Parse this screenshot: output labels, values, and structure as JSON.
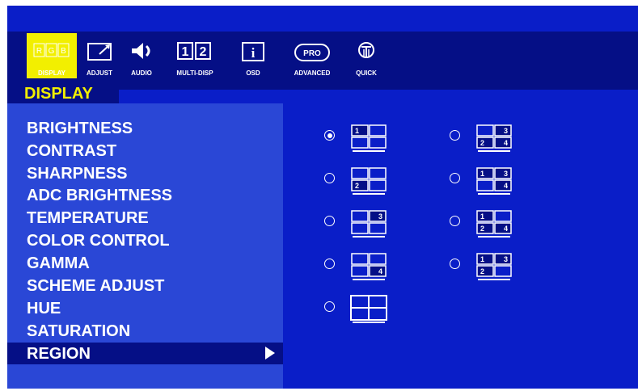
{
  "tabs": [
    {
      "label": "DISPLAY",
      "icon": "rgb-icon",
      "selected": true,
      "icon_text": [
        "R",
        "G",
        "B"
      ]
    },
    {
      "label": "ADJUST",
      "icon": "adjust-icon"
    },
    {
      "label": "AUDIO",
      "icon": "speaker-icon"
    },
    {
      "label": "MULTI-DISP",
      "icon": "multi-display-icon",
      "icon_text": [
        "1",
        "2"
      ]
    },
    {
      "label": "OSD",
      "icon": "info-icon",
      "icon_text": "i"
    },
    {
      "label": "ADVANCED",
      "icon": "pro-icon",
      "icon_text": "PRO"
    },
    {
      "label": "QUICK",
      "icon": "quick-icon"
    }
  ],
  "section_title": "DISPLAY",
  "menu": {
    "items": [
      "BRIGHTNESS",
      "CONTRAST",
      "SHARPNESS",
      "ADC BRIGHTNESS",
      "TEMPERATURE",
      "COLOR CONTROL",
      "GAMMA",
      "SCHEME ADJUST",
      "HUE",
      "SATURATION",
      "REGION"
    ],
    "selected_index": 10
  },
  "region_options": {
    "left": [
      {
        "layout": "quad",
        "numbers": [
          "1",
          "",
          "",
          ""
        ],
        "highlight": [
          0
        ],
        "selected": true
      },
      {
        "layout": "quad",
        "numbers": [
          "",
          "",
          "2",
          ""
        ],
        "highlight": [
          2
        ],
        "selected": false
      },
      {
        "layout": "quad",
        "numbers": [
          "",
          "3",
          "",
          ""
        ],
        "highlight": [
          1
        ],
        "selected": false
      },
      {
        "layout": "quad",
        "numbers": [
          "",
          "",
          "",
          "4"
        ],
        "highlight": [
          3
        ],
        "selected": false
      },
      {
        "layout": "full",
        "numbers": [
          "",
          "",
          "",
          ""
        ],
        "highlight": [],
        "selected": false
      }
    ],
    "right": [
      {
        "layout": "quad",
        "numbers": [
          "",
          "3",
          "2",
          "4"
        ],
        "highlight": [
          1,
          2,
          3
        ],
        "selected": false
      },
      {
        "layout": "quad",
        "numbers": [
          "1",
          "3",
          "",
          "4"
        ],
        "highlight": [
          0,
          1,
          3
        ],
        "selected": false
      },
      {
        "layout": "quad",
        "numbers": [
          "1",
          "",
          "2",
          "4"
        ],
        "highlight": [
          0,
          2,
          3
        ],
        "selected": false
      },
      {
        "layout": "quad",
        "numbers": [
          "1",
          "3",
          "2",
          ""
        ],
        "highlight": [
          0,
          1,
          2
        ],
        "selected": false
      }
    ]
  },
  "colors": {
    "panel": "#2a47d6",
    "background": "#0a1ec8",
    "dark": "#050f86",
    "accent": "#f2ef00",
    "text": "#ffffff"
  }
}
